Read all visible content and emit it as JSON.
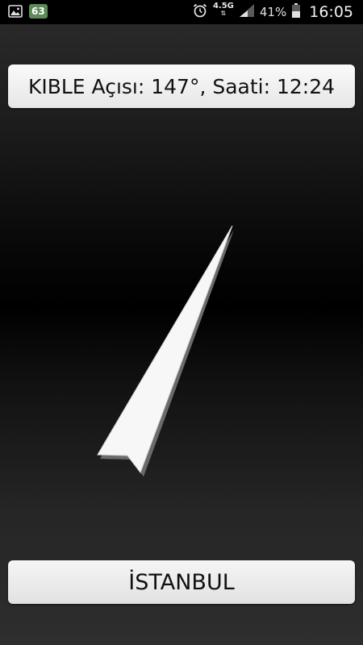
{
  "status_bar": {
    "notification_badge": "63",
    "network_type": "4.5G",
    "battery_percent": "41%",
    "time": "16:05",
    "icons": [
      "gallery-icon",
      "notification-badge",
      "alarm-icon",
      "data-arrows-icon",
      "signal-icon",
      "battery-icon"
    ]
  },
  "qibla": {
    "text": "KIBLE Açısı: 147°, Saati: 12:24",
    "angle_deg": 147
  },
  "city_button": {
    "label": "İSTANBUL"
  },
  "colors": {
    "arrow_fill": "#f7f7f7",
    "arrow_shadow": "#6b6b6b",
    "box_background": "#f0f0f0",
    "status_bar_background": "#000000"
  }
}
